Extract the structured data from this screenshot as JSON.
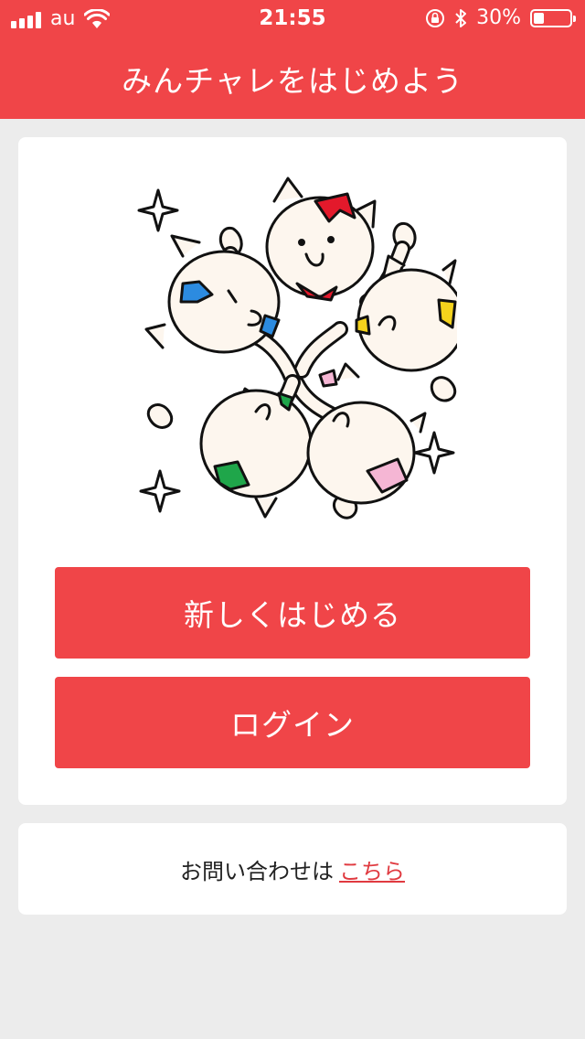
{
  "status_bar": {
    "carrier": "au",
    "time": "21:55",
    "battery_percent": "30%",
    "battery_level": 0.3,
    "icons": [
      "signal-icon",
      "wifi-icon",
      "orientation-lock-icon",
      "bluetooth-icon",
      "battery-icon"
    ]
  },
  "header": {
    "title": "みんチャレをはじめよう"
  },
  "main_card": {
    "illustration": "five-cats-group-illustration",
    "start_button_label": "新しくはじめる",
    "login_button_label": "ログイン"
  },
  "contact_card": {
    "text": "お問い合わせは",
    "link_label": "こちら"
  },
  "colors": {
    "brand_red": "#f04548",
    "background": "#ececec",
    "card": "#ffffff",
    "link": "#e03a40"
  }
}
